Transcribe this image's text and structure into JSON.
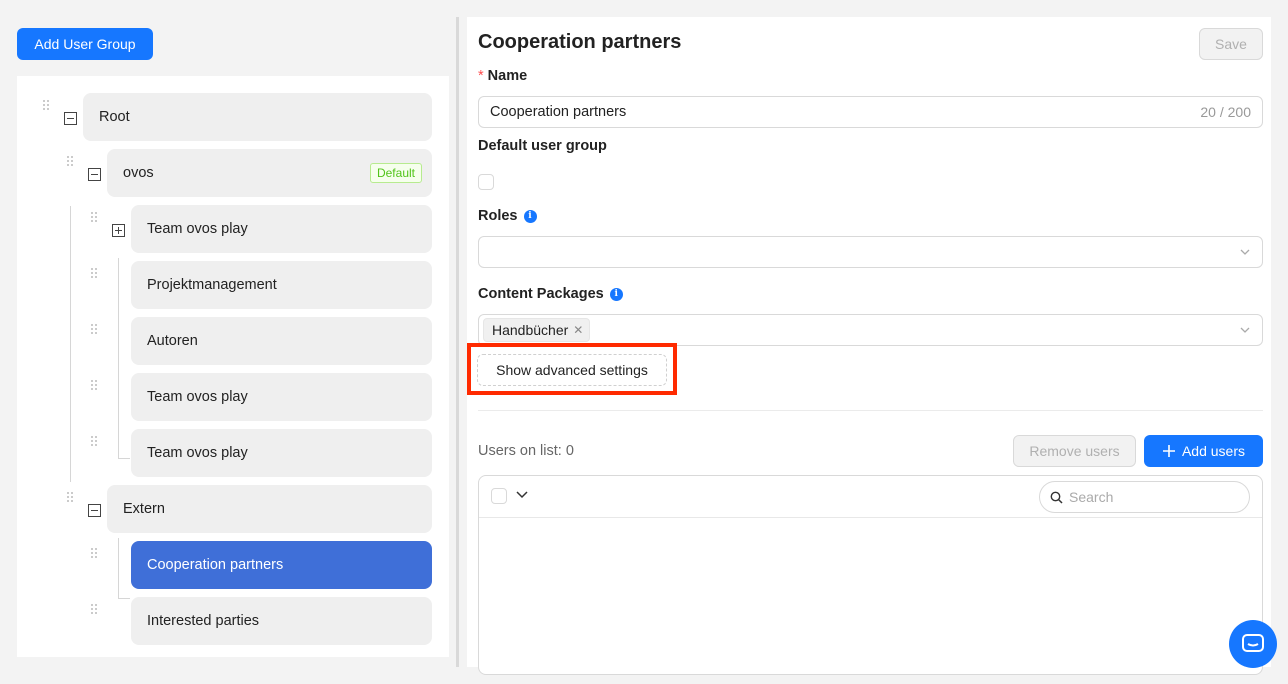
{
  "left_panel": {
    "add_group_label": "Add User Group",
    "tree": {
      "root": "Root",
      "ovos": "ovos",
      "default_badge": "Default",
      "team_ovos_play_1": "Team ovos play",
      "projektmanagement": "Projektmanagement",
      "autoren": "Autoren",
      "team_ovos_play_2": "Team ovos play",
      "team_ovos_play_3": "Team ovos play",
      "extern": "Extern",
      "cooperation_partners": "Cooperation partners",
      "interested_parties": "Interested parties"
    }
  },
  "form": {
    "title": "Cooperation partners",
    "save_label": "Save",
    "required_mark": "*",
    "name_label": "Name",
    "name_value": "Cooperation partners",
    "name_count": "20 / 200",
    "default_group_label": "Default user group",
    "default_group_checked": false,
    "roles_label": "Roles",
    "roles_value": "",
    "content_packages_label": "Content Packages",
    "content_packages_tags": [
      "Handbücher"
    ],
    "advanced_settings_label": "Show advanced settings"
  },
  "users": {
    "count_text": "Users on list: 0",
    "remove_label": "Remove users",
    "add_label": "Add users",
    "search_placeholder": "Search"
  },
  "colors": {
    "primary": "#1677ff",
    "selected_node": "#3f6fd8",
    "highlight": "#ff2a00",
    "default_badge": "#52c41a"
  },
  "icons": {
    "info": "info-icon",
    "chevron": "chevron-down-icon",
    "search": "search-icon",
    "plus": "plus-icon",
    "chat": "chat-icon",
    "drag": "drag-handle-icon"
  }
}
